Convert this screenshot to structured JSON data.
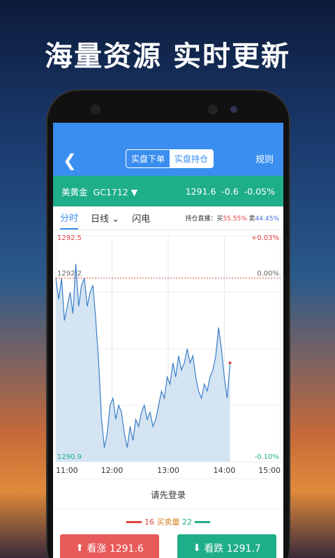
{
  "headline": "海量资源 实时更新",
  "topbar": {
    "back_icon": "chevron-left-icon",
    "tabs": [
      {
        "label": "实盘下单",
        "active": false
      },
      {
        "label": "实盘持仓",
        "active": true
      }
    ],
    "rules_label": "规则"
  },
  "quote": {
    "name": "美黄金",
    "code": "GC1712 ▼",
    "price": "1291.6",
    "change": "-0.6",
    "change_pct": "-0.05%"
  },
  "tabs": {
    "items": [
      "分时",
      "日线",
      "闪电"
    ],
    "active": "分时",
    "hold_prefix": "持仓直播：买",
    "buy_pct": "55.55%",
    "sell_prefix": "卖",
    "sell_pct": "44.45%"
  },
  "chart_data": {
    "type": "area",
    "y_labels_left": [
      "1292.5",
      "1292.2",
      "1290.9"
    ],
    "y_labels_right": [
      "+0.03%",
      "0.00%",
      "-0.10%"
    ],
    "x_labels": [
      "11:00",
      "12:00",
      "13:00",
      "14:00",
      "15:00"
    ],
    "reference_price": 1292.2,
    "ylim": [
      1290.9,
      1292.5
    ],
    "series": [
      {
        "values": [
          1292.2,
          1292.05,
          1292.2,
          1291.9,
          1292.0,
          1292.1,
          1291.95,
          1292.3,
          1292.0,
          1292.15,
          1292.2,
          1292.0,
          1292.1,
          1292.15,
          1291.9,
          1291.6,
          1291.2,
          1291.0,
          1291.1,
          1291.3,
          1291.35,
          1291.2,
          1291.3,
          1291.25,
          1291.1,
          1291.0,
          1291.15,
          1291.05,
          1291.2,
          1291.15,
          1291.25,
          1291.3,
          1291.2,
          1291.25,
          1291.15,
          1291.2,
          1291.3,
          1291.4,
          1291.35,
          1291.5,
          1291.45,
          1291.6,
          1291.5,
          1291.65,
          1291.55,
          1291.6,
          1291.7,
          1291.6,
          1291.65,
          1291.5,
          1291.4,
          1291.35,
          1291.45,
          1291.4,
          1291.5,
          1291.55,
          1291.65,
          1291.85,
          1291.7,
          1291.5,
          1291.35,
          1291.6
        ],
        "color": "#3a7ec8",
        "fill": "#d4e4f2"
      }
    ]
  },
  "login_label": "请先登录",
  "volume": {
    "buy": "16",
    "label": "买卖量",
    "sell": "22"
  },
  "buttons": {
    "up_label": "看涨 1291.6",
    "down_label": "看跌 1291.7"
  },
  "colors": {
    "accent": "#3a8ef0",
    "green": "#1fae8a",
    "red": "#e85a5a"
  }
}
